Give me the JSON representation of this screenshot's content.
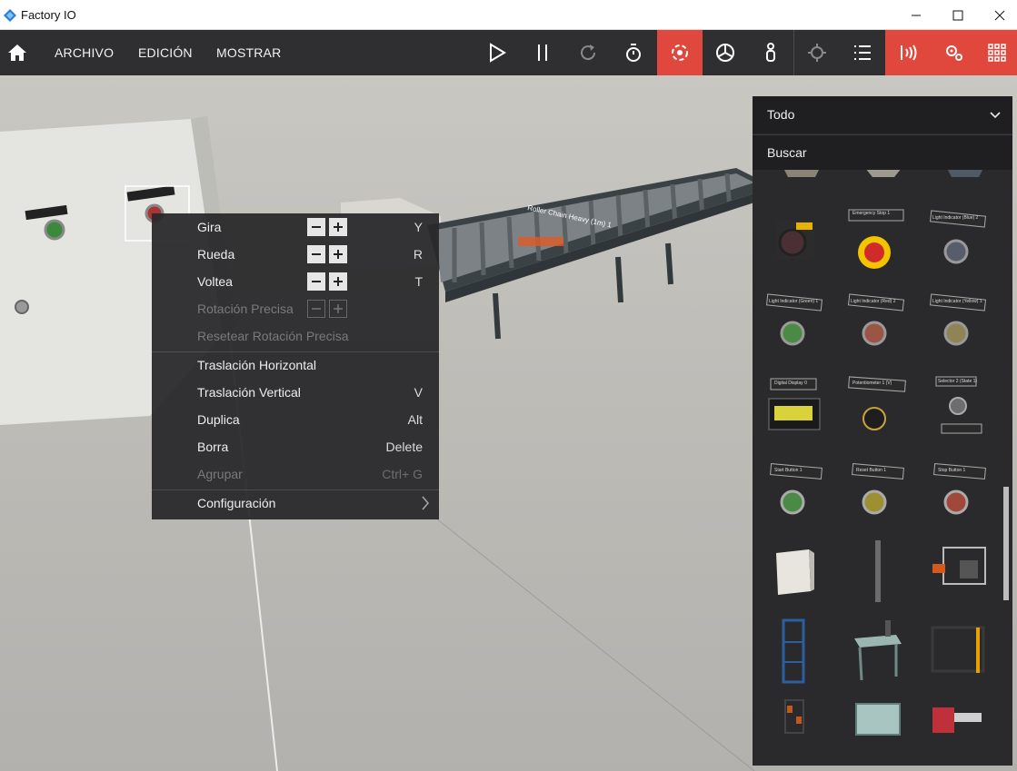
{
  "window": {
    "title": "Factory IO"
  },
  "menu": {
    "file": "ARCHIVO",
    "edit": "EDICIÓN",
    "view": "MOSTRAR"
  },
  "toolbar_icons": [
    "home-icon",
    "play-icon",
    "pause-icon",
    "reset-icon",
    "timer-icon",
    "edit-mode-icon",
    "fan-icon",
    "person-icon",
    "target-icon",
    "list-icon",
    "sensors-icon",
    "drivers-icon",
    "palette-icon"
  ],
  "context_menu": {
    "items": [
      {
        "label": "Gira",
        "key": "Y"
      },
      {
        "label": "Rueda",
        "key": "R"
      },
      {
        "label": "Voltea",
        "key": "T"
      },
      {
        "label": "Rotación Precisa",
        "key": ""
      },
      {
        "label": "Resetear Rotación Precisa",
        "key": ""
      },
      {
        "label": "Traslación Horizontal",
        "key": ""
      },
      {
        "label": "Traslación Vertical",
        "key": "V"
      },
      {
        "label": "Duplica",
        "key": "Alt"
      },
      {
        "label": "Borra",
        "key": "Delete"
      },
      {
        "label": "Agrupar",
        "key": "Ctrl+ G"
      },
      {
        "label": "Configuración",
        "key": ""
      }
    ]
  },
  "panel": {
    "filter": "Todo",
    "search": "Buscar",
    "parts": [
      "Emergency Stop 1",
      "Light Indicator (Blue) 2",
      "Light Indicator (Green) 1",
      "Light Indicator (Red) 2",
      "Light Indicator (Yellow) 1",
      "Digital Display 0",
      "Potentiometer 1 (V)",
      "Selector 2 (State 1)",
      "Start Button 1",
      "Reset Button 1",
      "Stop Button 1"
    ]
  },
  "scene": {
    "conveyor_label": "Roller Chain Heavy (1m) 1"
  },
  "colors": {
    "accent": "#e0473d",
    "toolbar": "#2f2f31",
    "panel": "#2a2a2c"
  }
}
